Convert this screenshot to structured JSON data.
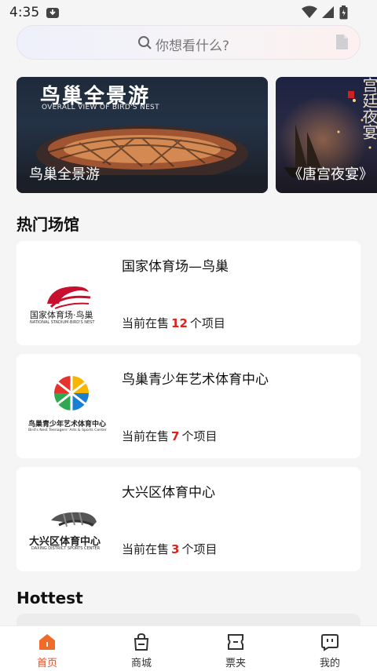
{
  "status": {
    "time": "4:35"
  },
  "search": {
    "placeholder": "你想看什么?"
  },
  "banners": [
    {
      "title": "鸟巢全景游",
      "subtitle": "OVERALL VIEW OF BIRD'S NEST",
      "caption": "鸟巢全景游"
    },
    {
      "title": "宫廷夜宴",
      "caption": "《唐宫夜宴》"
    }
  ],
  "sections": {
    "venues_title": "热门场馆",
    "hottest_title": "Hottest"
  },
  "venues": [
    {
      "name": "国家体育场—鸟巢",
      "sale_prefix": "当前在售",
      "count": "12",
      "sale_suffix": "个项目",
      "logo_text": "国家体育场·鸟巢",
      "logo_sub": "NATIONAL STADIUM·BIRD'S NEST"
    },
    {
      "name": "鸟巢青少年艺术体育中心",
      "sale_prefix": "当前在售",
      "count": "7",
      "sale_suffix": "个项目",
      "logo_text": "鸟巢青少年艺术体育中心",
      "logo_sub": "Bird's Nest Teenagers' Arts & Sports Center"
    },
    {
      "name": "大兴区体育中心",
      "sale_prefix": "当前在售",
      "count": "3",
      "sale_suffix": "个项目",
      "logo_text": "大兴区体育中心",
      "logo_sub": "DAXING DISTRICT SPORTS CENTER"
    }
  ],
  "tabs": [
    {
      "label": "首页",
      "icon": "home-icon"
    },
    {
      "label": "商城",
      "icon": "shopping-bag-icon"
    },
    {
      "label": "票夹",
      "icon": "ticket-icon"
    },
    {
      "label": "我的",
      "icon": "profile-icon"
    }
  ],
  "colors": {
    "accent": "#e8502a",
    "count": "#d9251c"
  }
}
